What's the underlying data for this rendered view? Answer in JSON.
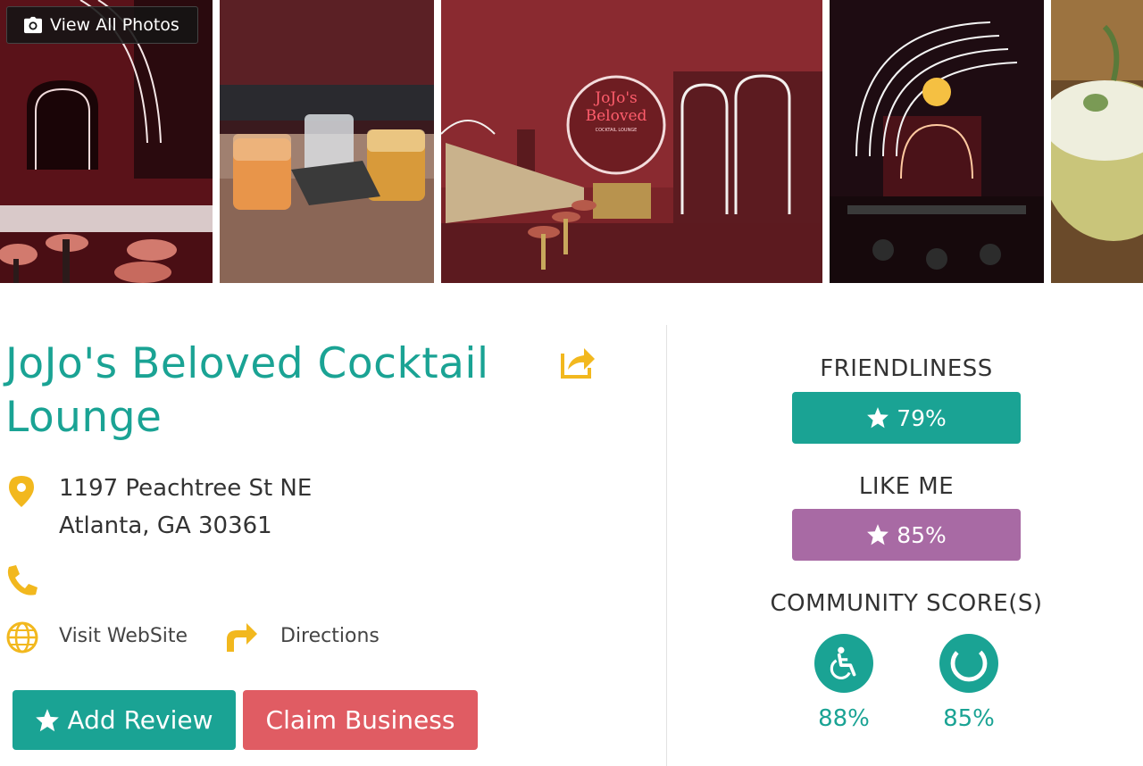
{
  "gallery": {
    "view_all_label": "View All Photos",
    "neon_sign_line1": "JoJo's",
    "neon_sign_line2": "Beloved",
    "neon_sign_line3": "COCKTAIL LOUNGE"
  },
  "business": {
    "name": "JoJo's Beloved Cocktail Lounge",
    "address_line1": "1197 Peachtree St NE",
    "address_line2": "Atlanta, GA 30361",
    "visit_website_label": "Visit WebSite",
    "directions_label": "Directions",
    "add_review_label": "Add Review",
    "claim_business_label": "Claim Business"
  },
  "scores": {
    "friendliness_label": "FRIENDLINESS",
    "friendliness_value": "79%",
    "like_me_label": "LIKE ME",
    "like_me_value": "85%",
    "community_label": "COMMUNITY SCORE(S)",
    "community": [
      {
        "icon": "wheelchair-icon",
        "value": "88%"
      },
      {
        "icon": "eye-icon",
        "value": "85%"
      }
    ]
  },
  "colors": {
    "teal": "#1aa394",
    "purple": "#a86aa4",
    "red": "#e05c63",
    "gold": "#f2b81e"
  }
}
